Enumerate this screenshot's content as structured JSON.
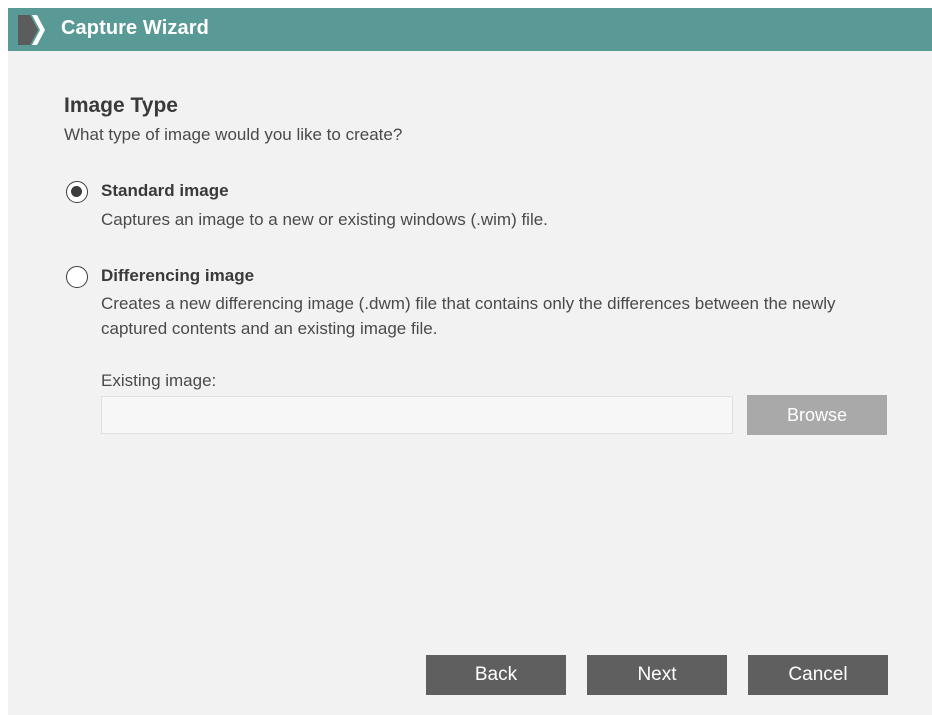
{
  "window": {
    "title": "Capture Wizard",
    "title_bar_color": "#5a9a96"
  },
  "page": {
    "title": "Image Type",
    "subtitle": "What type of image would you like to create?"
  },
  "options": [
    {
      "label": "Standard image",
      "description": "Captures an image to a new or existing windows (.wim) file.",
      "selected": true
    },
    {
      "label": "Differencing image",
      "description": "Creates a new differencing image (.dwm) file that contains only the differences between the newly captured contents and an existing image file.",
      "selected": false
    }
  ],
  "existing_image": {
    "label": "Existing image:",
    "value": "",
    "browse_label": "Browse",
    "enabled": false
  },
  "footer": {
    "back_label": "Back",
    "next_label": "Next",
    "cancel_label": "Cancel"
  },
  "icons": {
    "app": "wizard-chevron-icon"
  }
}
